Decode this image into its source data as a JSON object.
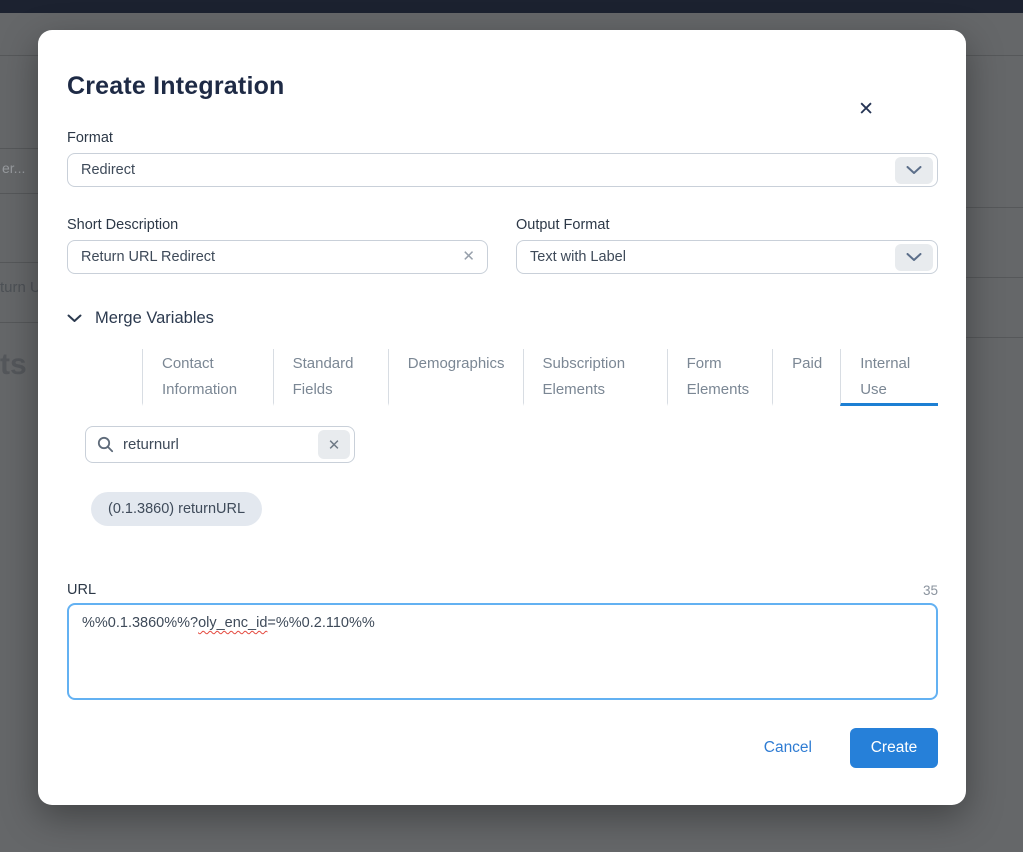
{
  "backdrop": {
    "top_bar_color": "#1c2230",
    "overlay_color": "#656769",
    "partial_texts": {
      "filter_fragment": "er...",
      "link_fragment": "turn U",
      "heading_fragment": "ts"
    }
  },
  "icons": {
    "close": "✕",
    "clear": "✕"
  },
  "modal": {
    "title": "Create Integration",
    "format": {
      "label": "Format",
      "value": "Redirect"
    },
    "short_description": {
      "label": "Short Description",
      "value": "Return URL Redirect"
    },
    "output_format": {
      "label": "Output Format",
      "value": "Text with Label"
    },
    "merge_variables": {
      "label": "Merge Variables",
      "tabs": [
        {
          "label": "Contact Information",
          "active": false
        },
        {
          "label": "Standard Fields",
          "active": false
        },
        {
          "label": "Demographics",
          "active": false
        },
        {
          "label": "Subscription Elements",
          "active": false
        },
        {
          "label": "Form Elements",
          "active": false
        },
        {
          "label": "Paid",
          "active": false
        },
        {
          "label": "Internal Use",
          "active": true
        }
      ],
      "search": {
        "value": "returnurl"
      },
      "chip": "(0.1.3860) returnURL"
    },
    "url": {
      "label": "URL",
      "counter": "35",
      "value_before": "%%0.1.3860%%?",
      "value_misspelled": "oly_enc_id",
      "value_after": "=%%0.2.110%%"
    },
    "footer": {
      "cancel_label": "Cancel",
      "create_label": "Create"
    }
  },
  "colors": {
    "accent": "#2680d9",
    "tab_underline": "#1d7fd3",
    "textarea_focus_border": "#63b1f2",
    "spellcheck_red": "#e4483e"
  }
}
